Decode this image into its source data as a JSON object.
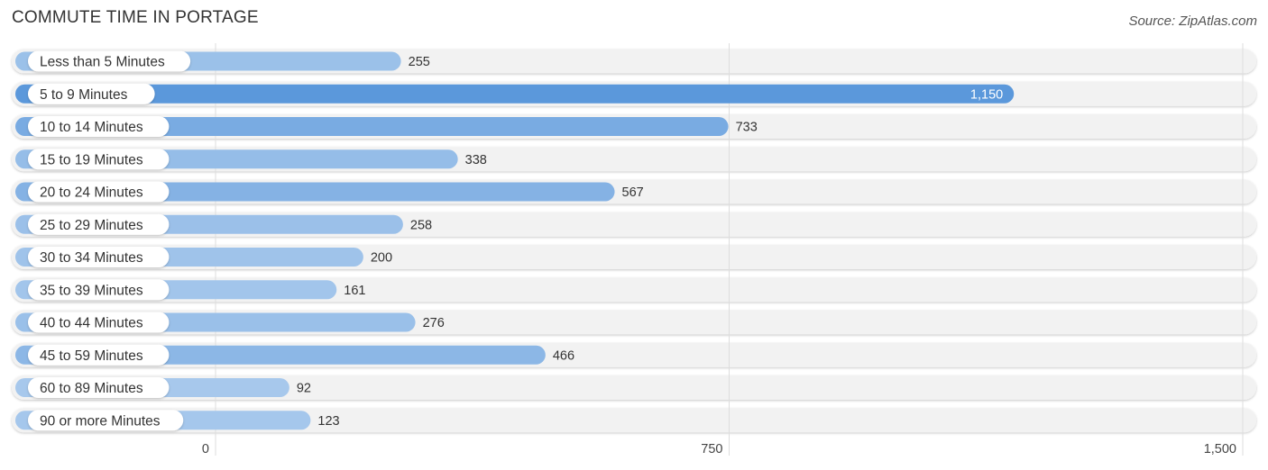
{
  "chart_data": {
    "type": "bar",
    "orientation": "horizontal",
    "title": "COMMUTE TIME IN PORTAGE",
    "source": "Source: ZipAtlas.com",
    "categories": [
      "Less than 5 Minutes",
      "5 to 9 Minutes",
      "10 to 14 Minutes",
      "15 to 19 Minutes",
      "20 to 24 Minutes",
      "25 to 29 Minutes",
      "30 to 34 Minutes",
      "35 to 39 Minutes",
      "40 to 44 Minutes",
      "45 to 59 Minutes",
      "60 to 89 Minutes",
      "90 or more Minutes"
    ],
    "values": [
      255,
      1150,
      733,
      338,
      567,
      258,
      200,
      161,
      276,
      466,
      92,
      123
    ],
    "value_labels": [
      "255",
      "1,150",
      "733",
      "338",
      "567",
      "258",
      "200",
      "161",
      "276",
      "466",
      "92",
      "123"
    ],
    "xlim": [
      0,
      1500
    ],
    "xticks": [
      0,
      750,
      1500
    ],
    "xtick_labels": [
      "0",
      "750",
      "1,500"
    ],
    "grid": true,
    "colors": {
      "bar_light": "#a7c8ec",
      "bar_dark": "#5b98db",
      "track": "#f2f2f2",
      "grid": "#dddddd"
    }
  }
}
